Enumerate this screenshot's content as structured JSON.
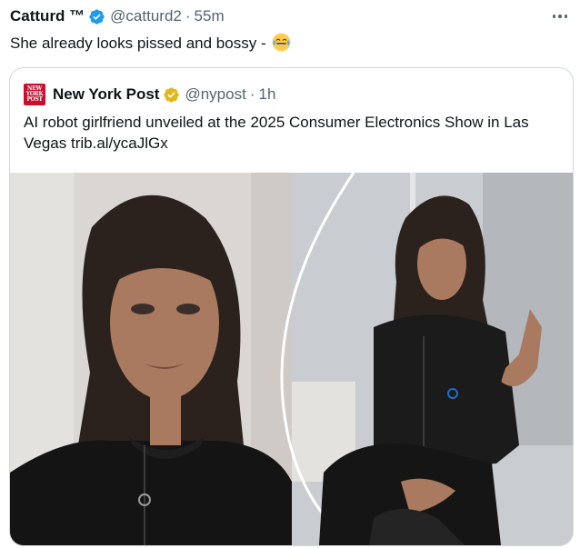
{
  "tweet": {
    "author_name": "Catturd ™",
    "author_handle": "@catturd2",
    "separator": "·",
    "time": "55m",
    "text": "She already looks pissed and bossy - "
  },
  "quoted": {
    "logo_text": [
      "NEW",
      "YORK",
      "POST"
    ],
    "author_name": "New York Post",
    "author_handle": "@nypost",
    "separator": "·",
    "time": "1h",
    "text": "AI robot girlfriend unveiled at the 2025 Consumer Electronics Show in Las Vegas ",
    "link": "trib.al/ycaJlGx"
  },
  "colors": {
    "verified_blue": "#1d9bf0",
    "verified_gold": "#e2b719",
    "nypost_red": "#c8102e",
    "muted_text": "#536471",
    "border": "#cfd9de"
  },
  "icons": {
    "verified": "blue-check-badge",
    "org_verified": "gold-check-badge",
    "more": "horizontal-ellipsis",
    "emoji": "face-with-tears-of-joy"
  }
}
